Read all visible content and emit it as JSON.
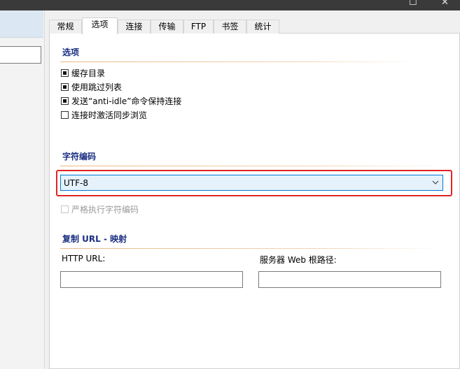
{
  "title_bar": {
    "maximize_glyph": "☐",
    "close_glyph": "✕"
  },
  "tabs": [
    {
      "label": "常规"
    },
    {
      "label": "选项"
    },
    {
      "label": "连接"
    },
    {
      "label": "传输"
    },
    {
      "label": "FTP"
    },
    {
      "label": "书签"
    },
    {
      "label": "统计"
    }
  ],
  "active_tab": "选项",
  "options": {
    "title": "选项",
    "checkboxes": [
      {
        "label": "缓存目录",
        "checked": true
      },
      {
        "label": "使用跳过列表",
        "checked": true
      },
      {
        "label": "发送“anti-idle”命令保持连接",
        "checked": true
      },
      {
        "label": "连接时激活同步浏览",
        "checked": false
      }
    ]
  },
  "encoding": {
    "title": "字符编码",
    "selected": "UTF-8",
    "strict_label": "严格执行字符编码",
    "strict_checked": false,
    "strict_enabled": false
  },
  "url_mapping": {
    "title": "复制 URL - 映射",
    "http_url_label": "HTTP URL:",
    "http_url_value": "",
    "web_root_label": "服务器 Web 根路径:",
    "web_root_value": ""
  },
  "colors": {
    "accent": "#0078d7",
    "section_title": "#1a2f83",
    "highlight": "#e02424"
  }
}
